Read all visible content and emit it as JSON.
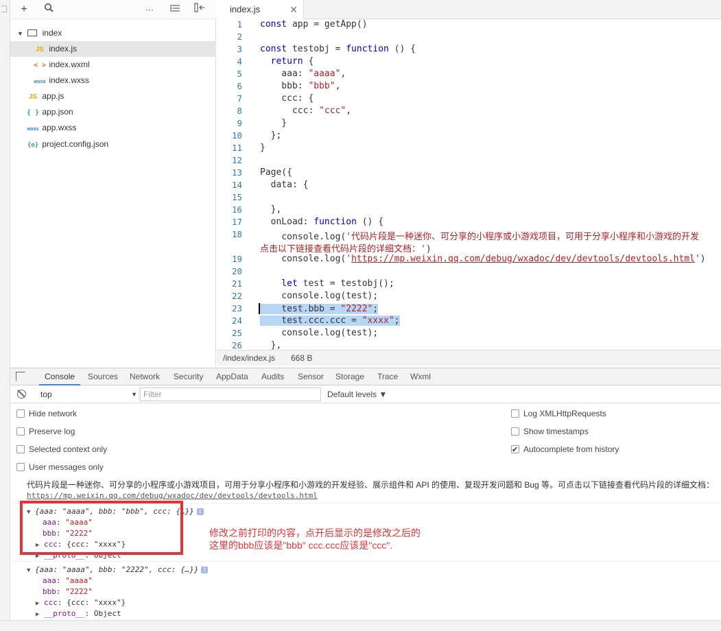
{
  "tree": {
    "folder": "index",
    "items": [
      {
        "label": "index.js",
        "icon": "JS",
        "type": "js",
        "selected": true
      },
      {
        "label": "index.wxml",
        "icon": "< >",
        "type": "wxml"
      },
      {
        "label": "index.wxss",
        "icon": "wxss",
        "type": "wxss"
      },
      {
        "label": "app.js",
        "icon": "JS",
        "type": "js"
      },
      {
        "label": "app.json",
        "icon": "{ }",
        "type": "json"
      },
      {
        "label": "app.wxss",
        "icon": "wxss",
        "type": "wxss"
      },
      {
        "label": "project.config.json",
        "icon": "{o}",
        "type": "cfg"
      }
    ]
  },
  "editor": {
    "tab_label": "index.js",
    "close_glyph": "✕",
    "line_numbers": [
      "1",
      "2",
      "3",
      "4",
      "5",
      "6",
      "7",
      "8",
      "9",
      "10",
      "11",
      "12",
      "13",
      "14",
      "15",
      "16",
      "17",
      "18",
      "19",
      "20",
      "21",
      "22",
      "23",
      "24",
      "25",
      "26"
    ],
    "lines": {
      "l1a": "const",
      "l1b": " app = getApp()",
      "l3a": "const",
      "l3b": " testobj = ",
      "l3c": "function",
      "l3d": " () {",
      "l4a": "  return",
      "l4b": " {",
      "l5a": "    aaa: ",
      "l5b": "\"aaaa\"",
      "l5c": ",",
      "l6a": "    bbb: ",
      "l6b": "\"bbb\"",
      "l6c": ",",
      "l7": "    ccc: {",
      "l8a": "      ccc: ",
      "l8b": "\"ccc\"",
      "l8c": ",",
      "l9": "    }",
      "l10": "  };",
      "l11": "}",
      "l13": "Page({",
      "l14": "  data: {",
      "l16": "  },",
      "l17a": "  onLoad: ",
      "l17b": "function",
      "l17c": " () {",
      "l18a": "    console.log(",
      "l18b": "'代码片段是一种迷你、可分享的小程序或小游戏项目，可用于分享小程序和小游戏的开发",
      "l18c": "点击以下链接查看代码片段的详细文档：'",
      "l18d": ")",
      "l19a": "    console.log(",
      "l19b": "'",
      "l19c": "https://mp.weixin.qq.com/debug/wxadoc/dev/devtools/devtools.html",
      "l19d": "'",
      "l19e": ")",
      "l21a": "    let",
      "l21b": " test = testobj();",
      "l22": "    console.log(test);",
      "l23a": "    test.bbb = ",
      "l23b": "\"2222\"",
      "l23c": ";",
      "l24a": "    test.ccc.ccc = ",
      "l24b": "\"xxxx\"",
      "l24c": ";",
      "l25": "    console.log(test);",
      "l26": "  },"
    }
  },
  "statusbar": {
    "path": "/index/index.js",
    "size": "668 B"
  },
  "devtools": {
    "tabs": [
      "Console",
      "Sources",
      "Network",
      "Security",
      "AppData",
      "Audits",
      "Sensor",
      "Storage",
      "Trace",
      "Wxml"
    ],
    "context": "top",
    "context_arrow": "▼",
    "filter_placeholder": "Filter",
    "levels": "Default levels ▼",
    "options_left": [
      {
        "label": "Hide network",
        "checked": false
      },
      {
        "label": "Preserve log",
        "checked": false
      },
      {
        "label": "Selected context only",
        "checked": false
      },
      {
        "label": "User messages only",
        "checked": false
      }
    ],
    "options_right": [
      {
        "label": "Log XMLHttpRequests",
        "checked": false
      },
      {
        "label": "Show timestamps",
        "checked": false
      },
      {
        "label": "Autocomplete from history",
        "checked": true
      }
    ]
  },
  "console": {
    "msg1": "代码片段是一种迷你、可分享的小程序或小游戏项目，可用于分享小程序和小游戏的开发经验、展示组件和 API 的使用、复现开发问题和 Bug 等。可点击以下链接查看代码片段的详细文档：",
    "msg2": "https://mp.weixin.qq.com/debug/wxadoc/dev/devtools/devtools.html",
    "obj1_summary": "{aaa: \"aaaa\", bbb: \"bbb\", ccc: {…}}",
    "obj2_summary": "{aaa: \"aaaa\", bbb: \"2222\", ccc: {…}}",
    "prop_aaa": "\"aaaa\"",
    "prop_bbb": "\"2222\"",
    "prop_ccc": "{ccc: \"xxxx\"}",
    "proto_key": "__proto__",
    "proto_val": "Object",
    "info_badge": "i"
  },
  "annotation": {
    "line1": "修改之前打印的内容，点开后显示的是修改之后的",
    "line2": "这里的bbb应该是\"bbb\" ccc.ccc应该是\"ccc\"."
  }
}
